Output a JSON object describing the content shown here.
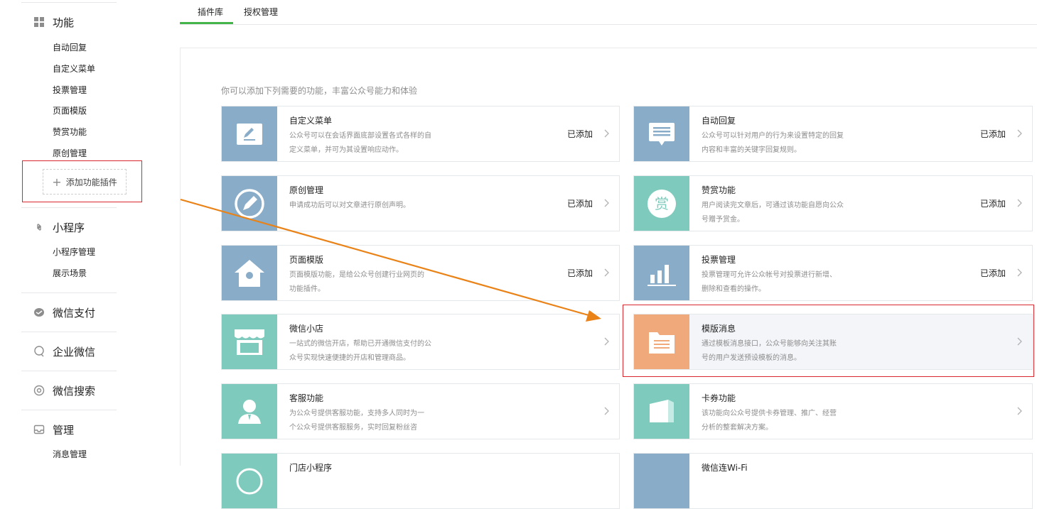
{
  "sidebar": {
    "function_title": "功能",
    "function_items": [
      "自动回复",
      "自定义菜单",
      "投票管理",
      "页面模版",
      "赞赏功能",
      "原创管理"
    ],
    "add_plugin_label": "添加功能插件",
    "miniprogram_title": "小程序",
    "miniprogram_items": [
      "小程序管理",
      "展示场景"
    ],
    "wechatpay_title": "微信支付",
    "enterprise_title": "企业微信",
    "search_title": "微信搜索",
    "manage_title": "管理",
    "manage_items": [
      "消息管理"
    ]
  },
  "tabs": [
    "插件库",
    "授权管理"
  ],
  "intro": "你可以添加下列需要的功能，丰富公众号能力和体验",
  "cards": [
    {
      "title": "自定义菜单",
      "desc": "公众号可以在会话界面底部设置各式各样的自定义菜单，并可为其设置响应动作。",
      "status": "已添加",
      "icon": "pencil-icon",
      "color": "#89acc8"
    },
    {
      "title": "自动回复",
      "desc": "公众号可以针对用户的行为来设置特定的回复内容和丰富的关键字回复规则。",
      "status": "已添加",
      "icon": "message-icon",
      "color": "#89acc8"
    },
    {
      "title": "原创管理",
      "desc": "申请成功后可以对文章进行原创声明。",
      "status": "已添加",
      "icon": "compass-icon",
      "color": "#89acc8"
    },
    {
      "title": "赞赏功能",
      "desc": "用户阅读完文章后，可通过该功能自愿向公众号赠予赏金。",
      "status": "已添加",
      "icon": "reward-icon",
      "color": "#7ecbbd"
    },
    {
      "title": "页面模版",
      "desc": "页面模版功能，是给公众号创建行业网页的功能插件。",
      "status": "已添加",
      "icon": "house-icon",
      "color": "#89acc8"
    },
    {
      "title": "投票管理",
      "desc": "投票管理可允许公众帐号对投票进行新增、删除和查看的操作。",
      "status": "已添加",
      "icon": "bar-chart-icon",
      "color": "#89acc8"
    },
    {
      "title": "微信小店",
      "desc": "一站式的微信开店，帮助已开通微信支付的公众号实现快速便捷的开店和管理商品。",
      "status": "",
      "icon": "shop-icon",
      "color": "#7ecbbd"
    },
    {
      "title": "模版消息",
      "desc": "通过模板消息接口，公众号能够向关注其账号的用户发送预设模板的消息。",
      "status": "",
      "icon": "folder-icon",
      "color": "#f0a97b"
    },
    {
      "title": "客服功能",
      "desc": "为公众号提供客服功能，支持多人同时为一个公众号提供客服服务，实时回复粉丝咨",
      "status": "",
      "icon": "user-icon",
      "color": "#7ecbbd"
    },
    {
      "title": "卡券功能",
      "desc": "该功能向公众号提供卡券管理、推广、经营分析的整套解决方案。",
      "status": "",
      "icon": "card-icon",
      "color": "#7ecbbd"
    },
    {
      "title": "门店小程序",
      "desc": "",
      "status": "",
      "icon": "store-icon",
      "color": "#7ecbbd"
    },
    {
      "title": "微信连Wi-Fi",
      "desc": "",
      "status": "",
      "icon": "wifi-icon",
      "color": "#89acc8"
    }
  ],
  "colors": {
    "accent_green": "#44b549",
    "highlight_red": "#d9282d",
    "arrow_orange": "#e98217"
  }
}
